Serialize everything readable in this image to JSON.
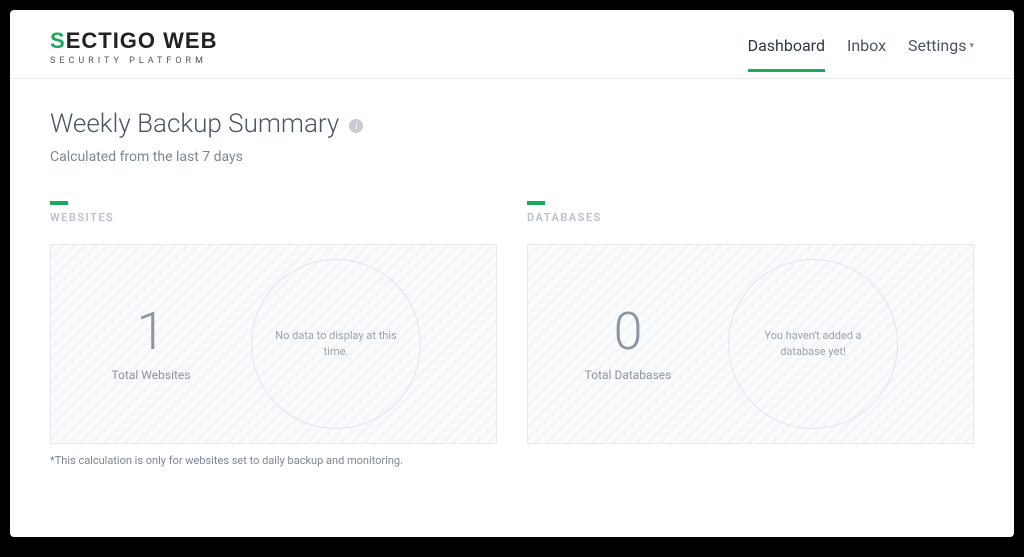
{
  "brand": {
    "name": "SECTIGO WEB",
    "tagline": "SECURITY PLATFORM"
  },
  "nav": {
    "dashboard": "Dashboard",
    "inbox": "Inbox",
    "settings": "Settings"
  },
  "page": {
    "title": "Weekly Backup Summary",
    "subtitle": "Calculated from the last 7 days",
    "footnote": "*This calculation is only for websites set to daily backup and monitoring."
  },
  "cards": {
    "websites": {
      "heading": "WEBSITES",
      "count": "1",
      "label": "Total Websites",
      "circle_message": "No data to display at this time."
    },
    "databases": {
      "heading": "DATABASES",
      "count": "0",
      "label": "Total Databases",
      "circle_message": "You haven't added a database yet!"
    }
  }
}
